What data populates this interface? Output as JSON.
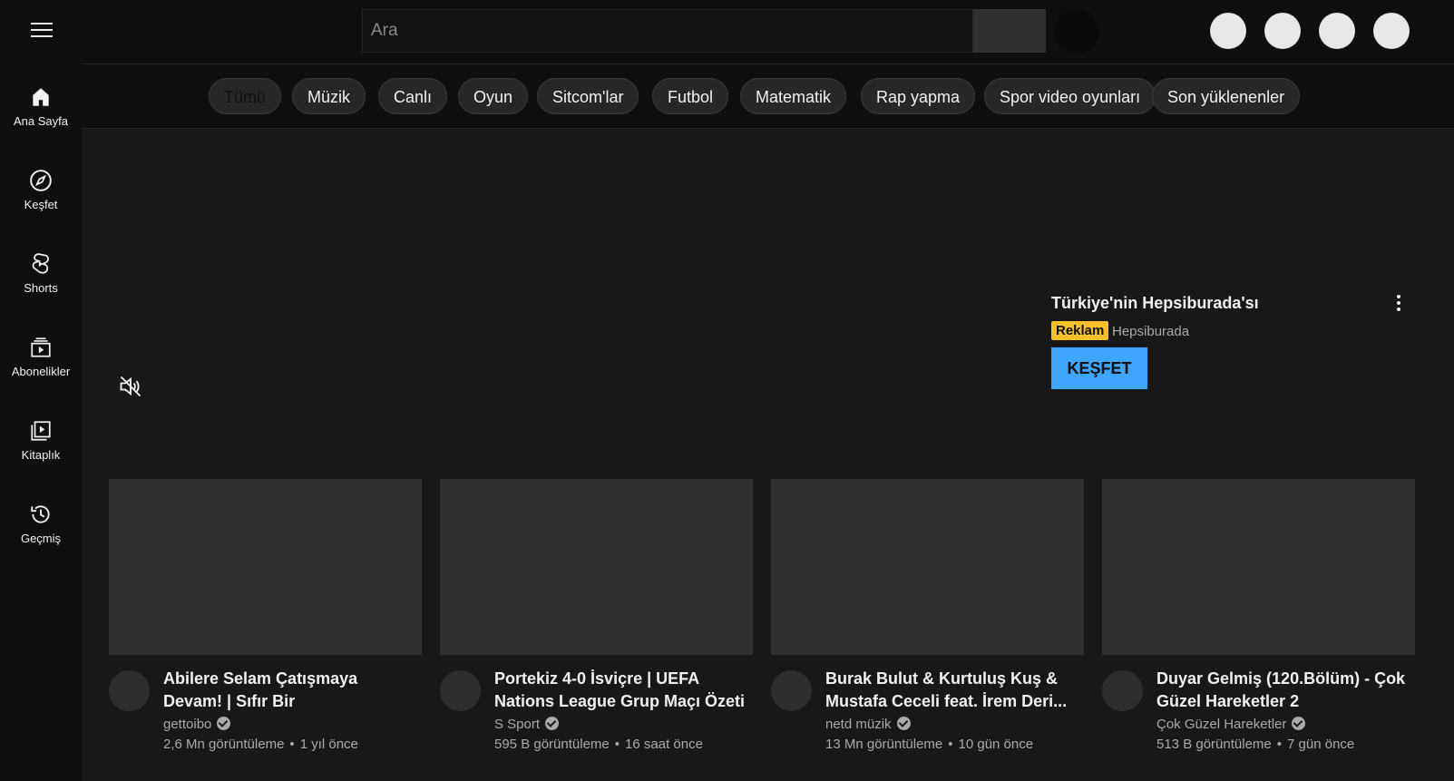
{
  "search": {
    "placeholder": "Ara"
  },
  "sidebar": {
    "items": [
      {
        "label": "Ana Sayfa",
        "icon": "home-icon"
      },
      {
        "label": "Keşfet",
        "icon": "compass-icon"
      },
      {
        "label": "Shorts",
        "icon": "shorts-icon"
      },
      {
        "label": "Abonelikler",
        "icon": "subscriptions-icon"
      },
      {
        "label": "Kitaplık",
        "icon": "library-icon"
      },
      {
        "label": "Geçmiş",
        "icon": "history-icon"
      }
    ]
  },
  "chips": [
    "Tümü",
    "Müzik",
    "Canlı",
    "Oyun",
    "Sitcom'lar",
    "Futbol",
    "Matematik",
    "Rap yapma",
    "Spor video oyunları",
    "Son yüklenenler"
  ],
  "ad": {
    "title": "Türkiye'nin Hepsiburada'sı",
    "badge": "Reklam",
    "advertiser": "Hepsiburada",
    "cta": "KEŞFET",
    "badge_color": "#f8c12b",
    "cta_color": "#3ea6ff"
  },
  "videos": [
    {
      "title": "Abilere Selam Çatışmaya Devam! | Sıfır Bir",
      "channel": "gettoibo",
      "views": "2,6 Mn görüntüleme",
      "age": "1 yıl önce"
    },
    {
      "title": "Portekiz 4-0 İsviçre | UEFA Nations League Grup Maçı Özeti",
      "channel": "S Sport",
      "views": "595 B görüntüleme",
      "age": "16 saat önce"
    },
    {
      "title": "Burak Bulut & Kurtuluş Kuş & Mustafa Ceceli feat. İrem Deri...",
      "channel": "netd müzik",
      "views": "13 Mn görüntüleme",
      "age": "10 gün önce"
    },
    {
      "title": "Duyar Gelmiş (120.Bölüm) - Çok Güzel Hareketler 2",
      "channel": "Çok Güzel Hareketler",
      "views": "513 B görüntüleme",
      "age": "7 gün önce"
    }
  ],
  "separator": "•"
}
